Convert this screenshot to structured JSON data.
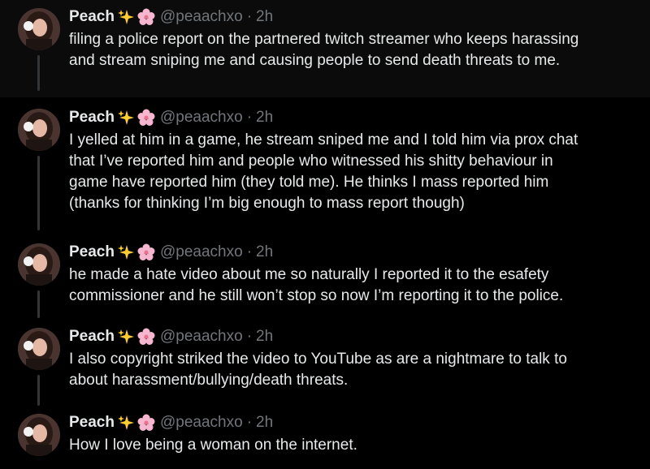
{
  "colors": {
    "background": "#000000",
    "text": "#e7e9ea",
    "muted": "#71767b",
    "thread_line": "#333639"
  },
  "tweets": [
    {
      "name": "Peach",
      "emojis": [
        "sparkles-icon",
        "cherry-blossom-icon"
      ],
      "handle": "@peaachxo",
      "dot": "·",
      "time": "2h",
      "text": "filing a police report on the partnered twitch streamer who keeps harassing\nand stream sniping me and causing people to send death threats to me."
    },
    {
      "name": "Peach",
      "emojis": [
        "sparkles-icon",
        "cherry-blossom-icon"
      ],
      "handle": "@peaachxo",
      "dot": "·",
      "time": "2h",
      "text": "I yelled at him in a game, he stream sniped me and I told him via prox chat\nthat I’ve reported him and people who witnessed his shitty behaviour in\ngame have reported him (they told me). He thinks I mass reported him\n(thanks for thinking I’m big enough to mass report though)"
    },
    {
      "name": "Peach",
      "emojis": [
        "sparkles-icon",
        "cherry-blossom-icon"
      ],
      "handle": "@peaachxo",
      "dot": "·",
      "time": "2h",
      "text": "he made a hate video about me so naturally I reported it to the esafety\ncommissioner and he still won’t stop so now I’m reporting it to the police."
    },
    {
      "name": "Peach",
      "emojis": [
        "sparkles-icon",
        "cherry-blossom-icon"
      ],
      "handle": "@peaachxo",
      "dot": "·",
      "time": "2h",
      "text": "I also copyright striked the video to YouTube as are a nightmare to talk to\nabout harassment/bullying/death threats."
    },
    {
      "name": "Peach",
      "emojis": [
        "sparkles-icon",
        "cherry-blossom-icon"
      ],
      "handle": "@peaachxo",
      "dot": "·",
      "time": "2h",
      "text": "How I love being a woman on the internet."
    }
  ]
}
